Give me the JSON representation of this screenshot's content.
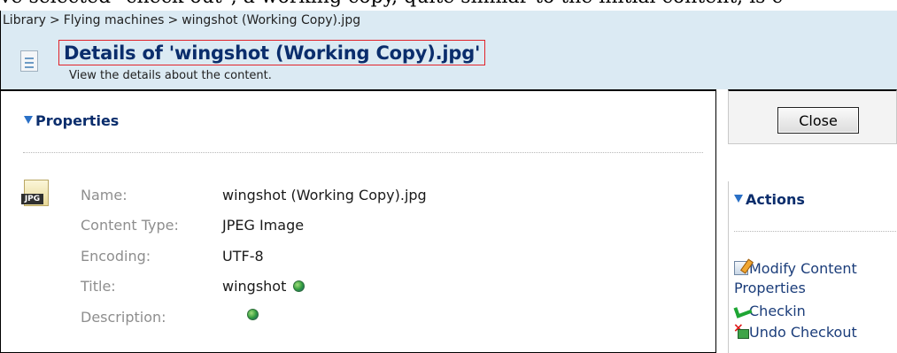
{
  "top_caption": "ve selected \"check out\", a working copy, quite similar to the initial content, is c",
  "breadcrumb": {
    "items": [
      "Library",
      "Flying machines",
      "wingshot (Working Copy).jpg"
    ],
    "separator": ">"
  },
  "header": {
    "title": "Details of 'wingshot (Working Copy).jpg'",
    "subtitle": "View the details about the content."
  },
  "properties": {
    "heading": "Properties",
    "icon_text": "JPG",
    "rows": [
      {
        "label": "Name:",
        "value": "wingshot (Working Copy).jpg"
      },
      {
        "label": "Content Type:",
        "value": "JPEG Image"
      },
      {
        "label": "Encoding:",
        "value": "UTF-8"
      },
      {
        "label": "Title:",
        "value": "wingshot"
      },
      {
        "label": "Description:",
        "value": ""
      }
    ]
  },
  "close_label": "Close",
  "actions": {
    "heading": "Actions",
    "items": [
      {
        "label_line1": "Modify Content",
        "label_line2": "Properties"
      },
      {
        "label_line1": "Checkin"
      },
      {
        "label_line1": "Undo Checkout"
      }
    ]
  },
  "colors": {
    "header_bg": "#dbeaf3",
    "title_blue": "#0a2d6c",
    "highlight_red": "#e2232a",
    "label_gray": "#8e8e8e"
  }
}
